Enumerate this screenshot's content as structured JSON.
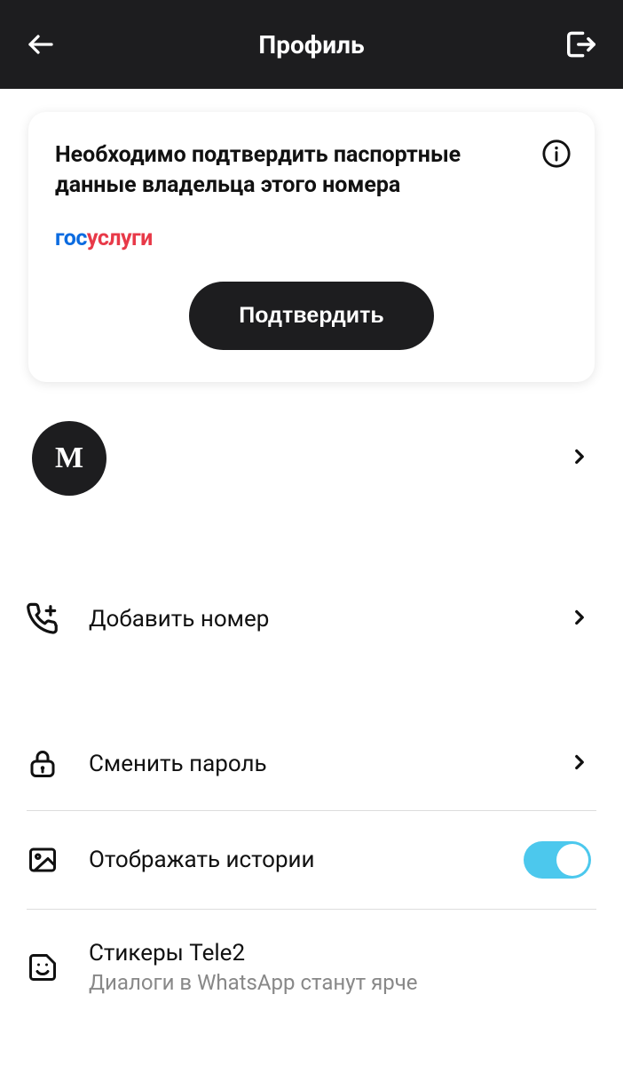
{
  "header": {
    "title": "Профиль"
  },
  "card": {
    "title": "Необходимо подтвердить паспортные данные владельца этого номера",
    "gosuslugi_part1": "гос",
    "gosuslugi_part2": "услуги",
    "confirm_label": "Подтвердить"
  },
  "profile": {
    "avatar_letter": "М"
  },
  "menu": {
    "add_number": "Добавить номер",
    "change_password": "Сменить пароль",
    "show_stories": "Отображать истории",
    "stickers_title": "Стикеры Tele2",
    "stickers_subtitle": "Диалоги в WhatsApp станут ярче"
  }
}
